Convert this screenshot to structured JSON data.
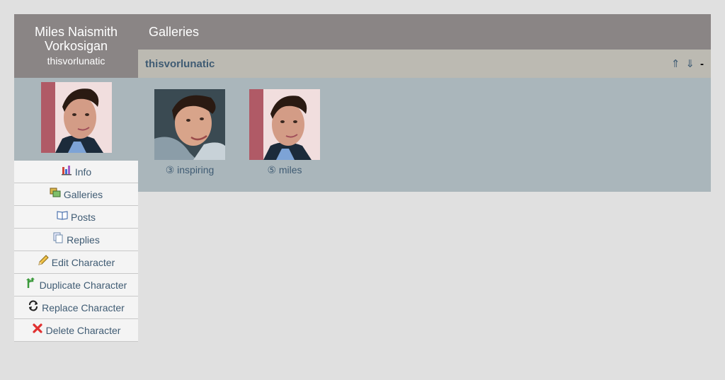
{
  "character": {
    "name": "Miles Naismith Vorkosigan",
    "screenname": "thisvorlunatic"
  },
  "nav": [
    {
      "label": "Info",
      "icon": "bar-chart-icon"
    },
    {
      "label": "Galleries",
      "icon": "gallery-icon"
    },
    {
      "label": "Posts",
      "icon": "book-icon"
    },
    {
      "label": "Replies",
      "icon": "pages-icon"
    },
    {
      "label": "Edit Character",
      "icon": "pencil-icon"
    },
    {
      "label": "Duplicate Character",
      "icon": "branch-icon"
    },
    {
      "label": "Replace Character",
      "icon": "refresh-icon"
    },
    {
      "label": "Delete Character",
      "icon": "x-icon"
    }
  ],
  "page": {
    "title": "Galleries"
  },
  "gallery": {
    "title": "thisvorlunatic",
    "controls": {
      "up": "⇑",
      "down": "⇓",
      "collapse": "-"
    },
    "icons": [
      {
        "caption": "③ inspiring"
      },
      {
        "caption": "⑤ miles"
      }
    ]
  },
  "colors": {
    "header_bg": "#8a8585",
    "panel_bg": "#aab6bb",
    "gallery_header_bg": "#bcbab2",
    "link": "#3f5b73"
  }
}
